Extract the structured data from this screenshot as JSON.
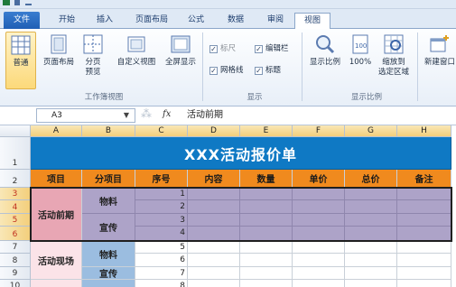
{
  "ribbon": {
    "tabs": [
      "文件",
      "开始",
      "插入",
      "页面布局",
      "公式",
      "数据",
      "审阅",
      "视图"
    ],
    "active_tab": "视图",
    "workbook_views": {
      "normal": "普通",
      "page_layout": "页面布局",
      "page_break_line1": "分页",
      "page_break_line2": "预览",
      "custom_views": "自定义视图",
      "full_screen": "全屏显示",
      "group_label": "工作簿视图"
    },
    "show": {
      "ruler": "标尺",
      "formula_bar": "编辑栏",
      "gridlines": "网格线",
      "headings": "标题",
      "group_label": "显示"
    },
    "zoom": {
      "zoom": "显示比例",
      "hundred": "100%",
      "to_selection_line1": "缩放到",
      "to_selection_line2": "选定区域",
      "group_label": "显示比例"
    },
    "window": {
      "new_window": "新建窗口"
    }
  },
  "formula_bar": {
    "name_box": "A3",
    "fx": "fx",
    "value": "活动前期"
  },
  "sheet": {
    "columns": [
      "A",
      "B",
      "C",
      "D",
      "E",
      "F",
      "G",
      "H"
    ],
    "rows": [
      "1",
      "2",
      "3",
      "4",
      "5",
      "6",
      "7",
      "8",
      "9",
      "10"
    ],
    "title": "XXX活动报价单",
    "headers": [
      "项目",
      "分项目",
      "序号",
      "内容",
      "数量",
      "单价",
      "总价",
      "备注"
    ],
    "group1": "活动前期",
    "group2": "活动现场",
    "sub_material": "物料",
    "sub_promo": "宣传",
    "sub_material2": "物料",
    "sub_promo2": "宣传",
    "seq": [
      "1",
      "2",
      "3",
      "4",
      "5",
      "6",
      "7",
      "8"
    ]
  }
}
